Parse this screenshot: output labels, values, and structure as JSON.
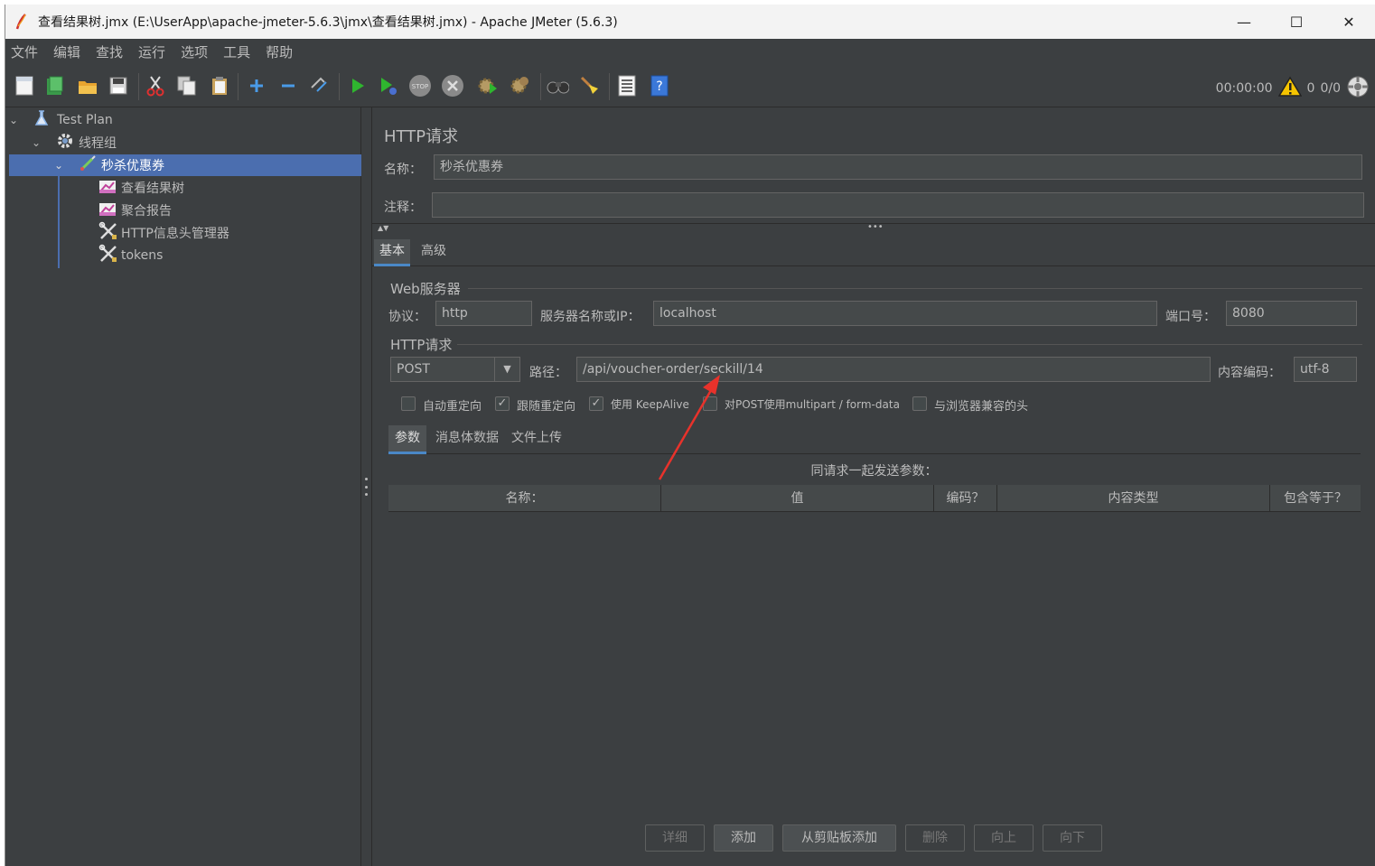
{
  "window": {
    "title": "查看结果树.jmx (E:\\UserApp\\apache-jmeter-5.6.3\\jmx\\查看结果树.jmx) - Apache JMeter (5.6.3)",
    "minimize": "—",
    "maximize": "☐",
    "close": "✕"
  },
  "menu": [
    "文件",
    "编辑",
    "查找",
    "运行",
    "选项",
    "工具",
    "帮助"
  ],
  "toolbar": {
    "timer": "00:00:00",
    "warnings": "0",
    "threads": "0/0"
  },
  "tree": {
    "items": [
      {
        "label": "Test Plan",
        "icon": "test-plan-icon"
      },
      {
        "label": "线程组",
        "icon": "gear-icon"
      },
      {
        "label": "秒杀优惠券",
        "icon": "sampler-pen-icon"
      },
      {
        "label": "查看结果树",
        "icon": "listener-chart-icon"
      },
      {
        "label": "聚合报告",
        "icon": "listener-chart-icon"
      },
      {
        "label": "HTTP信息头管理器",
        "icon": "config-tools-icon"
      },
      {
        "label": "tokens",
        "icon": "config-tools-icon"
      }
    ]
  },
  "sampler": {
    "panel_title": "HTTP请求",
    "name_label": "名称：",
    "name_value": "秒杀优惠券",
    "comment_label": "注释：",
    "comment_value": "",
    "tabs": [
      "基本",
      "高级"
    ],
    "web_server_title": "Web服务器",
    "protocol_label": "协议：",
    "protocol_value": "http",
    "server_label": "服务器名称或IP：",
    "server_value": "localhost",
    "port_label": "端口号：",
    "port_value": "8080",
    "http_request_title": "HTTP请求",
    "method_value": "POST",
    "path_label": "路径：",
    "path_value": "/api/voucher-order/seckill/14",
    "encoding_label": "内容编码：",
    "encoding_value": "utf-8",
    "checkboxes": [
      {
        "label": "自动重定向",
        "checked": false
      },
      {
        "label": "跟随重定向",
        "checked": true
      },
      {
        "label": "使用 KeepAlive",
        "checked": true
      },
      {
        "label": "对POST使用multipart / form-data",
        "checked": false
      },
      {
        "label": "与浏览器兼容的头",
        "checked": false
      }
    ],
    "subtabs": [
      "参数",
      "消息体数据",
      "文件上传"
    ],
    "params_caption": "同请求一起发送参数：",
    "columns": [
      "名称：",
      "值",
      "编码？",
      "内容类型",
      "包含等于？"
    ],
    "buttons": [
      {
        "label": "详细",
        "enabled": false
      },
      {
        "label": "添加",
        "enabled": true
      },
      {
        "label": "从剪贴板添加",
        "enabled": true
      },
      {
        "label": "删除",
        "enabled": false
      },
      {
        "label": "向上",
        "enabled": false
      },
      {
        "label": "向下",
        "enabled": false
      }
    ]
  },
  "colors": {
    "background": "#3c3f41",
    "field": "#45494a",
    "selection": "#4b6eaf",
    "annotation_arrow": "#e8322b"
  }
}
